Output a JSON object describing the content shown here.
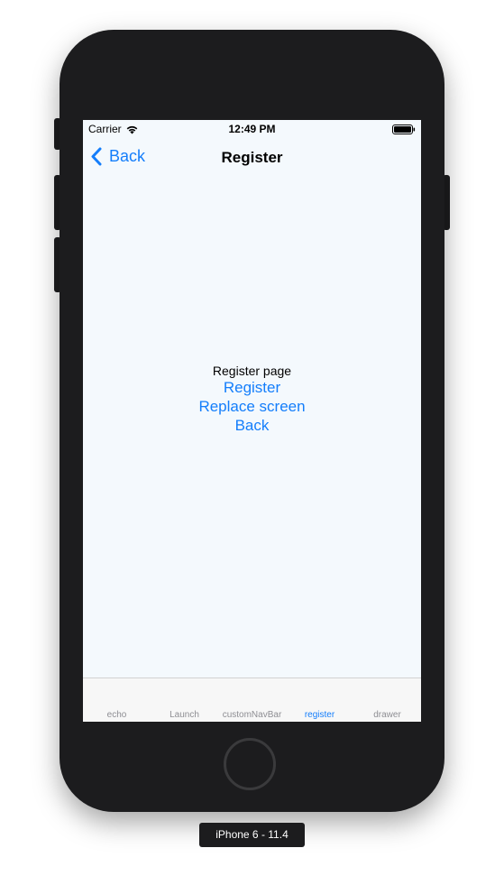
{
  "status_bar": {
    "carrier": "Carrier",
    "time": "12:49 PM",
    "wifi_icon": "wifi-icon",
    "battery_icon": "battery-icon"
  },
  "nav_bar": {
    "back_label": "Back",
    "back_icon": "chevron-left-icon",
    "title": "Register"
  },
  "content": {
    "page_label": "Register page",
    "links": {
      "register": "Register",
      "replace_screen": "Replace screen",
      "back": "Back"
    }
  },
  "tab_bar": {
    "tabs": [
      {
        "label": "echo"
      },
      {
        "label": "Launch"
      },
      {
        "label": "customNavBar"
      },
      {
        "label": "register"
      },
      {
        "label": "drawer"
      }
    ],
    "active_tab": "register"
  },
  "device_label": "iPhone 6 - 11.4",
  "colors": {
    "accent": "#147efb",
    "screen_background": "#f4f9fd",
    "device_body": "#1c1c1e"
  }
}
